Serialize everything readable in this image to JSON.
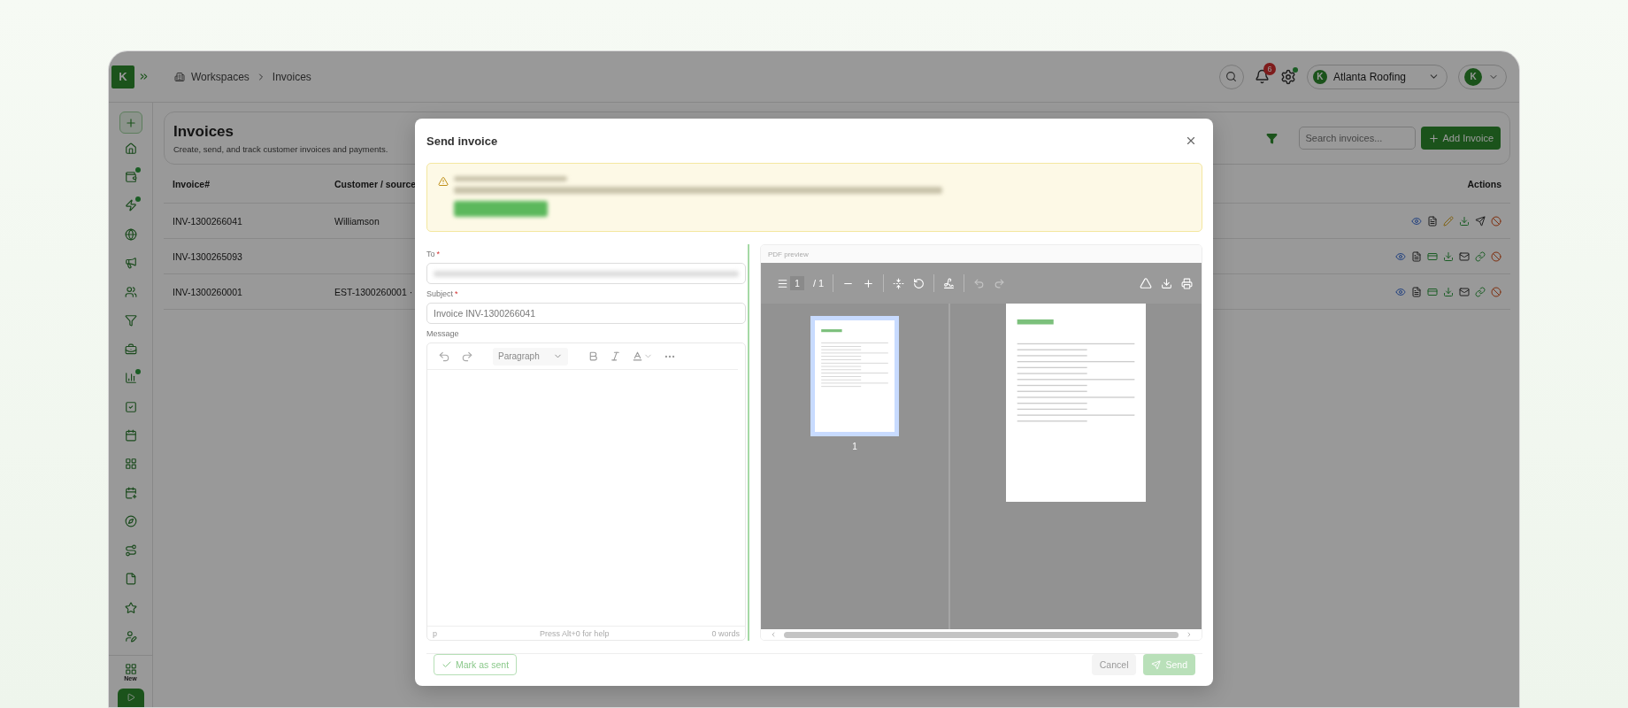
{
  "app": {
    "logo_letter": "K"
  },
  "breadcrumbs": [
    {
      "label": "Workspaces"
    },
    {
      "label": "Invoices"
    }
  ],
  "topbar": {
    "notifications": "6",
    "settings_dot": true,
    "organization_logo_letter": "K",
    "organization": "Atlanta Roofing",
    "avatar_letter": "K"
  },
  "sidebar": {
    "items": [
      {
        "dot": false
      },
      {
        "dot": true
      },
      {
        "dot": true
      },
      {
        "dot": false
      },
      {
        "dot": false
      },
      {
        "dot": false
      },
      {
        "dot": false
      },
      {
        "dot": false
      },
      {
        "dot": true
      },
      {
        "dot": false
      },
      {
        "dot": false
      },
      {
        "dot": false
      },
      {
        "dot": false
      },
      {
        "dot": false
      },
      {
        "dot": false
      },
      {
        "dot": false
      },
      {
        "dot": false
      },
      {
        "dot": false
      }
    ],
    "new_label": "New"
  },
  "page": {
    "title": "Invoices",
    "subtitle": "Create, send, and track customer invoices and payments.",
    "search_placeholder": "Search invoices...",
    "add_button": "Add Invoice"
  },
  "table": {
    "columns": [
      "Invoice#",
      "Customer / source",
      "Actions"
    ],
    "rows": [
      {
        "invoice": "INV-1300266041",
        "customer": "Williamson",
        "actions": [
          {
            "kind": "view"
          },
          {
            "kind": "pdf"
          },
          {
            "kind": "edit"
          },
          {
            "kind": "download"
          },
          {
            "kind": "send"
          },
          {
            "kind": "void"
          }
        ]
      },
      {
        "invoice": "INV-1300265093",
        "customer": "",
        "actions": [
          {
            "kind": "view"
          },
          {
            "kind": "pdf"
          },
          {
            "kind": "payment"
          },
          {
            "kind": "download"
          },
          {
            "kind": "email"
          },
          {
            "kind": "link"
          },
          {
            "kind": "void"
          }
        ]
      },
      {
        "invoice": "INV-1300260001",
        "customer": "EST-1300260001 ·",
        "actions": [
          {
            "kind": "view"
          },
          {
            "kind": "pdf"
          },
          {
            "kind": "payment"
          },
          {
            "kind": "download"
          },
          {
            "kind": "email"
          },
          {
            "kind": "link"
          },
          {
            "kind": "void"
          }
        ]
      }
    ]
  },
  "dialog": {
    "title": "Send invoice",
    "fields": [
      {
        "label": "To",
        "required_mark": "*",
        "kind": "blurred"
      },
      {
        "label": "Subject",
        "required_mark": "*",
        "kind": "text",
        "value": "Invoice INV-1300266041"
      }
    ],
    "message_label": "Message",
    "editor": {
      "block_format": "Paragraph",
      "path": "p",
      "help": "Press Alt+0 for help",
      "word_count": "0 words"
    },
    "preview": {
      "label": "PDF preview",
      "page": "1",
      "page_total": "/ 1",
      "thumbnail_label": "1"
    },
    "footer": {
      "mark_sent": "Mark as sent",
      "cancel": "Cancel",
      "send": "Send",
      "send_disabled": true
    }
  }
}
